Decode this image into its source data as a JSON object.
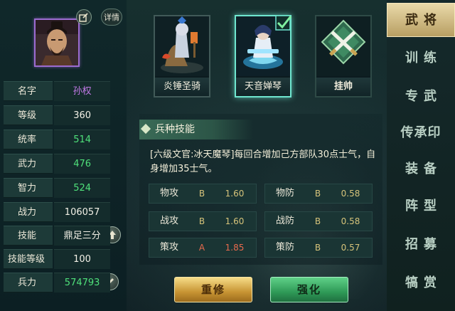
{
  "general": {
    "details_label": "详情",
    "stats": [
      {
        "label": "名字",
        "value": "孙权",
        "color": "purple"
      },
      {
        "label": "等级",
        "value": "360",
        "color": "white"
      },
      {
        "label": "统率",
        "value": "514",
        "color": "green"
      },
      {
        "label": "武力",
        "value": "476",
        "color": "green"
      },
      {
        "label": "智力",
        "value": "524",
        "color": "green"
      },
      {
        "label": "战力",
        "value": "106057",
        "color": "white"
      },
      {
        "label": "技能",
        "value": "鼎足三分",
        "color": "white"
      },
      {
        "label": "技能等级",
        "value": "100",
        "color": "white"
      },
      {
        "label": "兵力",
        "value": "574793",
        "color": "green"
      }
    ]
  },
  "units": [
    {
      "name": "炎锤圣骑",
      "selected": false
    },
    {
      "name": "天音婵琴",
      "selected": true
    },
    {
      "name": "挂帅",
      "selected": false
    }
  ],
  "skill": {
    "title": "兵种技能",
    "description": "[六级文官:冰天魔琴]每回合增加己方部队30点士气，自身增加35士气。",
    "combat_stats": [
      {
        "label": "物攻",
        "grade": "B",
        "value": "1.60"
      },
      {
        "label": "物防",
        "grade": "B",
        "value": "0.58"
      },
      {
        "label": "战攻",
        "grade": "B",
        "value": "1.60"
      },
      {
        "label": "战防",
        "grade": "B",
        "value": "0.58"
      },
      {
        "label": "策攻",
        "grade": "A",
        "value": "1.85"
      },
      {
        "label": "策防",
        "grade": "B",
        "value": "0.57"
      }
    ]
  },
  "actions": {
    "rebuild_label": "重修",
    "strengthen_label": "强化"
  },
  "tabs": [
    {
      "label": "武将",
      "active": true
    },
    {
      "label": "训练",
      "active": false
    },
    {
      "label": "专武",
      "active": false
    },
    {
      "label": "传承印",
      "active": false
    },
    {
      "label": "装备",
      "active": false
    },
    {
      "label": "阵型",
      "active": false
    },
    {
      "label": "招募",
      "active": false
    },
    {
      "label": "犒赏",
      "active": false
    }
  ],
  "colors": {
    "accent_gold": "#e9d9a9",
    "stat_green": "#4fe07a",
    "name_purple": "#c37ae8",
    "grade_a": "#e86a4d",
    "grade_b": "#d6c37a"
  }
}
